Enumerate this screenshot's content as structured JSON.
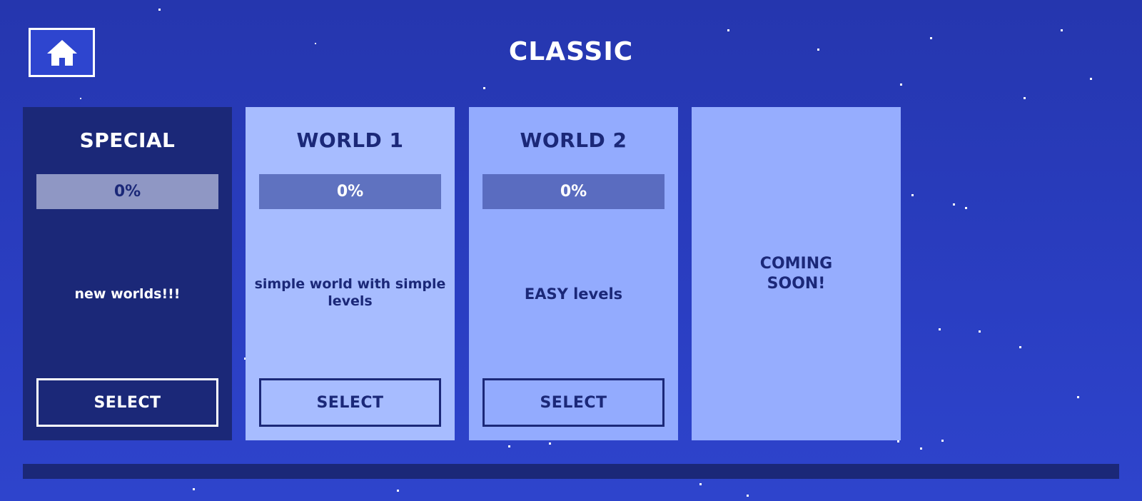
{
  "header": {
    "title": "CLASSIC",
    "home_icon": "home-icon"
  },
  "colors": {
    "background": "#2a3ec2",
    "special_card": "#1b2878",
    "world1_card": "#a7bcff",
    "world2_card": "#93abfe",
    "coming_soon_card": "#96adfe",
    "dark_text": "#1b2878"
  },
  "cards": [
    {
      "title": "SPECIAL",
      "progress_label": "0%",
      "progress": 0,
      "description": "new worlds!!!",
      "select_label": "SELECT"
    },
    {
      "title": "WORLD 1",
      "progress_label": "0%",
      "progress": 0,
      "description": "simple world with simple levels",
      "select_label": "SELECT"
    },
    {
      "title": "WORLD 2",
      "progress_label": "0%",
      "progress": 0,
      "description": "EASY levels",
      "select_label": "SELECT"
    }
  ],
  "coming_soon": {
    "text": "COMING\nSOON!"
  }
}
